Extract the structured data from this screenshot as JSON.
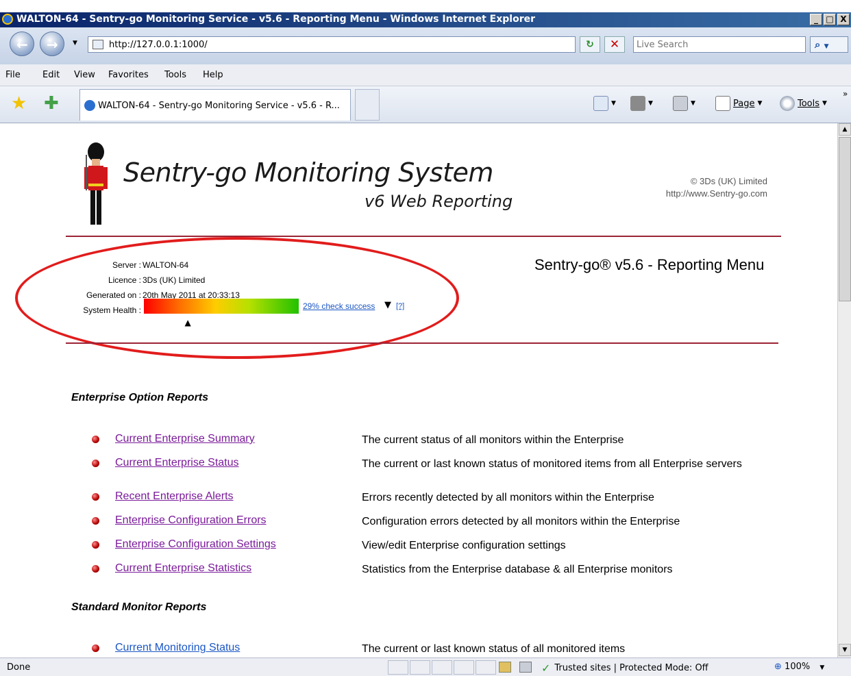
{
  "window": {
    "title": "WALTON-64 - Sentry-go Monitoring Service - v5.6 - Reporting Menu - Windows Internet Explorer",
    "buttons": [
      "_",
      "□",
      "X"
    ]
  },
  "navbar": {
    "address": "http://127.0.0.1:1000/",
    "search_placeholder": "Live Search"
  },
  "menubar": {
    "items": [
      "File",
      "Edit",
      "View",
      "Favorites",
      "Tools",
      "Help"
    ]
  },
  "favbar": {
    "tab_title": "WALTON-64 - Sentry-go Monitoring Service - v5.6 - R...",
    "page_label": "Page",
    "tools_label": "Tools",
    "chevron": "»"
  },
  "page": {
    "logo_title": "Sentry-go Monitoring System",
    "logo_subtitle": "v6 Web Reporting",
    "copyright": "© 3Ds (UK) Limited",
    "website": "http://www.Sentry-go.com",
    "menu_title": "Sentry-go® v5.6 - Reporting Menu",
    "info": {
      "server_label": "Server :",
      "server_value": "WALTON-64",
      "licence_label": "Licence :",
      "licence_value": "3Ds (UK) Limited",
      "generated_label": "Generated on :",
      "generated_value": "20th May 2011 at 20:33:13",
      "health_label": "System Health :",
      "health_value": 0.29,
      "health_link": "29% check success",
      "help_link": "[?]"
    },
    "sections": {
      "enterprise": "Enterprise Option Reports",
      "standard": "Standard Monitor Reports"
    },
    "enterprise_reports": [
      {
        "label": "Current Enterprise Summary",
        "desc": "The current status of all monitors within the Enterprise"
      },
      {
        "label": "Current Enterprise Status",
        "desc": "The current or last known status of monitored items from all Enterprise servers"
      },
      {
        "label": "Recent Enterprise Alerts",
        "desc": "Errors recently detected by all monitors within the Enterprise"
      },
      {
        "label": "Enterprise Configuration Errors",
        "desc": "Configuration errors detected by all monitors within the Enterprise"
      },
      {
        "label": "Enterprise Configuration Settings",
        "desc": "View/edit Enterprise configuration settings"
      },
      {
        "label": "Current Enterprise Statistics",
        "desc": "Statistics from the Enterprise database & all Enterprise monitors"
      }
    ],
    "standard_reports": [
      {
        "label": "Current Monitoring Status",
        "desc": "The current or last known status of all monitored items"
      }
    ]
  },
  "statusbar": {
    "left": "Done",
    "zone": "Trusted sites | Protected Mode: Off",
    "zoom": "100%"
  },
  "colors": {
    "accent_rule": "#9b2335",
    "annotation": "#e21c1c",
    "visited_link": "#7a1a9a",
    "link": "#1a56c4"
  }
}
